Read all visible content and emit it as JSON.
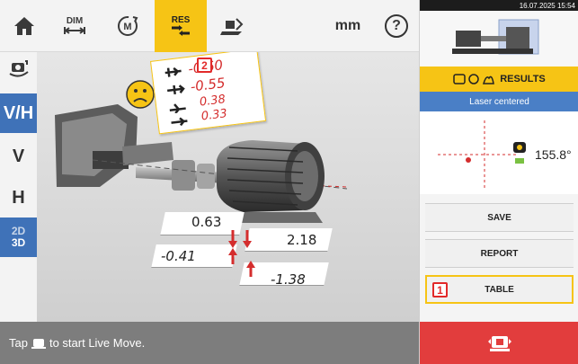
{
  "toolbar": {
    "home_icon": "home-icon",
    "dim_label": "DIM",
    "measure_label": "M",
    "res_label": "RES",
    "unit_label": "mm",
    "help_label": "?"
  },
  "sidebar": {
    "vh_label": "V/H",
    "v_label": "V",
    "h_label": "H",
    "dim2d_label": "2D",
    "dim3d_label": "3D"
  },
  "viewport": {
    "badge_2": "2",
    "vertical_values": [
      "-0.60",
      "-0.55"
    ],
    "horizontal_values": [
      "0.38",
      "0.33"
    ],
    "offset_top_left": "0.63",
    "offset_top_right": "2.18",
    "offset_bottom_left": "-0.41",
    "offset_bottom_right": "-1.38"
  },
  "status": {
    "hint_before": "Tap",
    "hint_after": "to start Live Move."
  },
  "right_panel": {
    "datetime": "16.07.2025 15:54",
    "results_label": "RESULTS",
    "laser_status": "Laser centered",
    "angle": "155.8°",
    "save_label": "SAVE",
    "report_label": "REPORT",
    "table_label": "TABLE",
    "badge_1": "1"
  },
  "colors": {
    "accent_yellow": "#f6c415",
    "active_blue": "#3f72b8",
    "laser_blue": "#4a7fc6",
    "alert_red": "#e23d3d",
    "value_red": "#d42d2d"
  }
}
